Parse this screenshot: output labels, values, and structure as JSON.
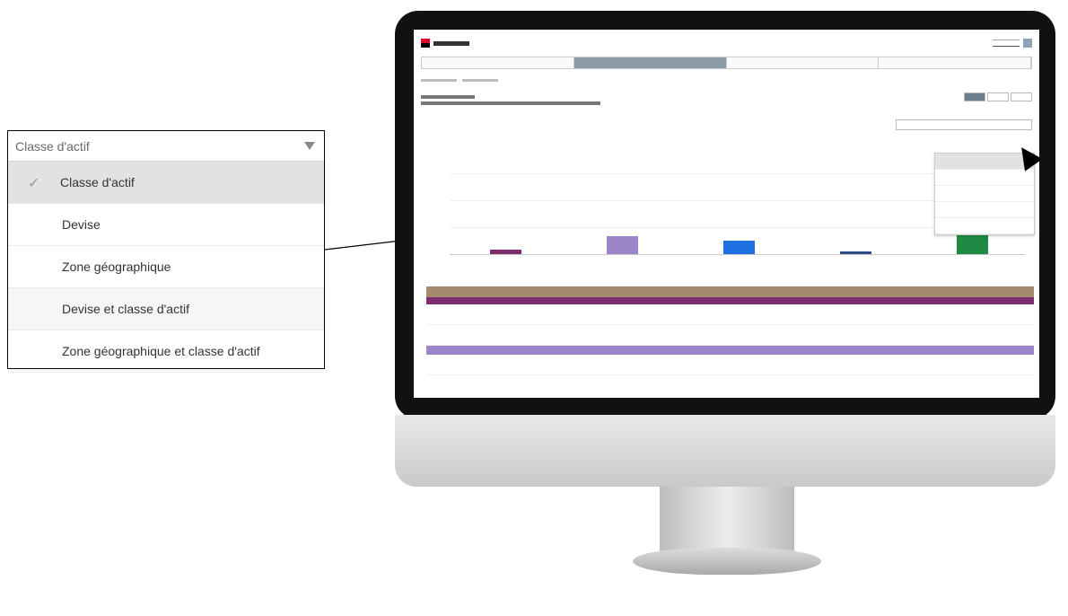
{
  "callout": {
    "selected_value": "Classe d'actif",
    "options": [
      {
        "label": "Classe d'actif",
        "selected": true
      },
      {
        "label": "Devise",
        "selected": false
      },
      {
        "label": "Zone géographique",
        "selected": false
      },
      {
        "label": "Devise et classe d'actif",
        "selected": false
      },
      {
        "label": "Zone géographique et classe d'actif",
        "selected": false
      }
    ]
  },
  "screen": {
    "brand_color": "#e4002b",
    "bar_colors": [
      "#7b2d6e",
      "#9b85c8",
      "#1f6fe0",
      "#2d4f88",
      "#1f8a44"
    ],
    "table_header_color": "#a68a6d"
  }
}
